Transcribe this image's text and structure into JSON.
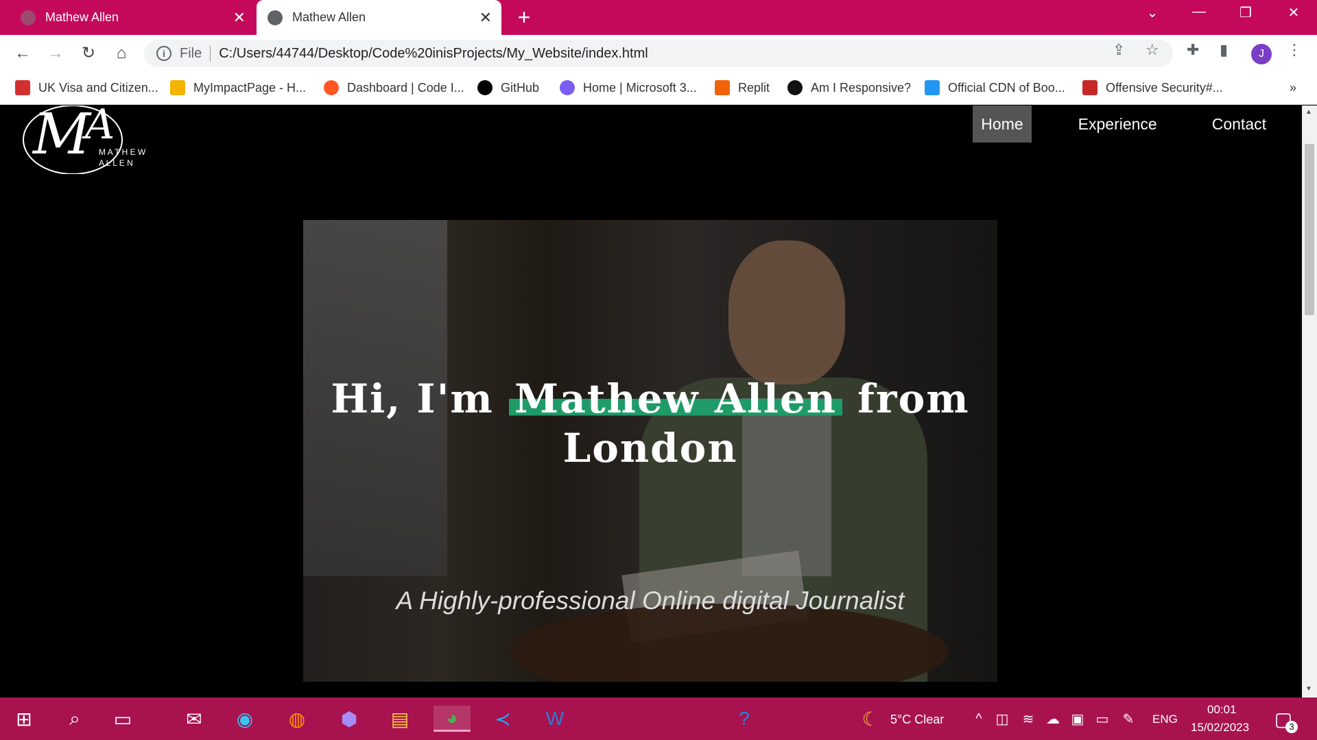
{
  "browser": {
    "tabs": [
      {
        "title": "Mathew Allen",
        "active": false
      },
      {
        "title": "Mathew Allen",
        "active": true
      }
    ],
    "address": {
      "scheme_label": "File",
      "url": "C:/Users/44744/Desktop/Code%20inisProjects/My_Website/index.html"
    },
    "profile_initial": "J",
    "bookmarks": [
      {
        "label": "UK Visa and Citizen...",
        "color": "#d32f2f"
      },
      {
        "label": "MyImpactPage - H...",
        "color": "#f4b400"
      },
      {
        "label": "Dashboard | Code I...",
        "color": "#ff5722"
      },
      {
        "label": "GitHub",
        "color": "#000000"
      },
      {
        "label": "Home | Microsoft 3...",
        "color": "#7b5cf2"
      },
      {
        "label": "Replit",
        "color": "#f26207"
      },
      {
        "label": "Am I Responsive?",
        "color": "#111111"
      },
      {
        "label": "Official CDN of Boo...",
        "color": "#2196f3"
      },
      {
        "label": "Offensive Security#...",
        "color": "#c62828"
      }
    ],
    "bookmarks_overflow": "»"
  },
  "site": {
    "logo_text_top": "M A T H E W",
    "logo_text_bottom": "A L L E N",
    "nav": {
      "home": "Home",
      "experience": "Experience",
      "contact": "Contact"
    },
    "hero": {
      "title_before": "Hi, I'm ",
      "title_highlight": "Mathew Allen",
      "title_after": " from",
      "title_line2": "London",
      "subtitle": "A Highly-professional Online digital Journalist",
      "highlight_color": "#1e9b68"
    }
  },
  "taskbar": {
    "weather": "5°C  Clear",
    "language": "ENG",
    "time": "00:01",
    "date": "15/02/2023",
    "notification_count": "3"
  },
  "colors": {
    "chrome_accent": "#c4095a",
    "taskbar": "#a8134f"
  }
}
